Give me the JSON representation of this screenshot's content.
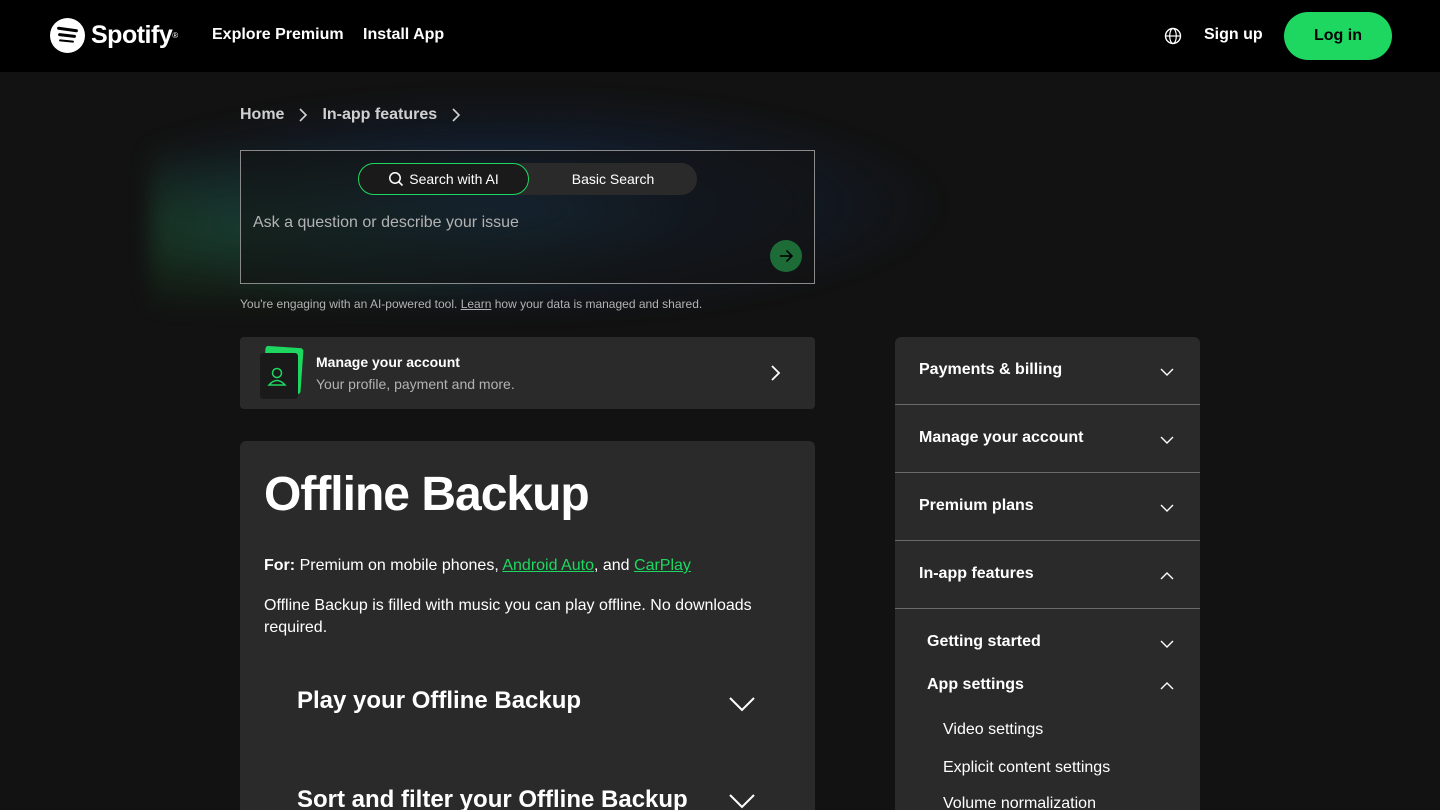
{
  "header": {
    "logo_text": "Spotify",
    "nav": [
      "Explore Premium",
      "Install App"
    ],
    "sign_up": "Sign up",
    "log_in": "Log in",
    "accent": "#1ed760"
  },
  "breadcrumb": [
    "Home",
    "In-app features"
  ],
  "search": {
    "toggle_ai": "Search with AI",
    "toggle_basic": "Basic Search",
    "placeholder": "Ask a question or describe your issue",
    "disclaimer_pre": "You're engaging with an AI-powered tool.",
    "disclaimer_link": "Learn",
    "disclaimer_post": "how your data is managed and shared."
  },
  "account_card": {
    "title": "Manage your account",
    "subtitle": "Your profile, payment and more."
  },
  "article": {
    "title": "Offline Backup",
    "for_label": "For:",
    "for_text": "Premium on mobile phones,",
    "link1": "Android Auto",
    "and_text": ", and",
    "link2": "CarPlay",
    "description": "Offline Backup is filled with music you can play offline. No downloads required.",
    "sections": [
      "Play your Offline Backup",
      "Sort and filter your Offline Backup"
    ]
  },
  "sidebar": {
    "items": [
      "Payments & billing",
      "Manage your account",
      "Premium plans",
      "In-app features"
    ],
    "sub_items": [
      "Getting started",
      "App settings"
    ],
    "sub_sub_items": [
      "Video settings",
      "Explicit content settings",
      "Volume normalization"
    ]
  }
}
